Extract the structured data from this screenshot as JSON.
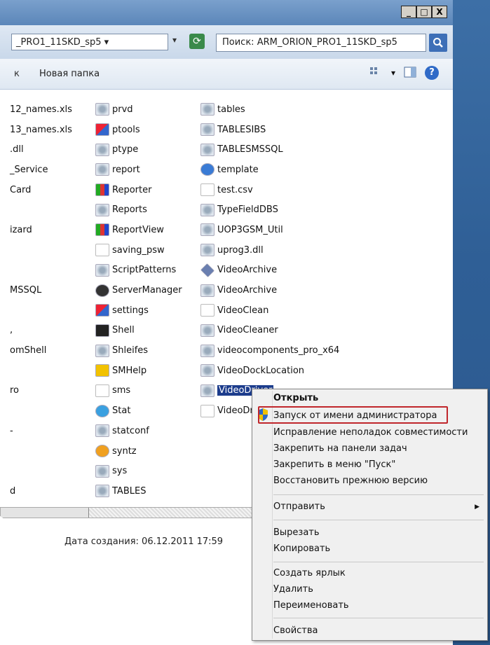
{
  "window": {
    "controls": [
      "_",
      "□",
      "X"
    ]
  },
  "address": {
    "path": "_PRO1_11SKD_sp5 ▾",
    "dropdown": "▾",
    "search_text": "Поиск: ARM_ORION_PRO1_11SKD_sp5"
  },
  "toolbar": {
    "back_label": "к",
    "new_folder_label": "Новая папка",
    "view_icon": "view-icon",
    "dropdown": "▾"
  },
  "files": {
    "col1": [
      "12_names.xls",
      "13_names.xls",
      ".dll",
      "_Service",
      "Card",
      "",
      "izard",
      "",
      "",
      "MSSQL",
      "",
      ",",
      "omShell",
      "",
      "ro",
      "",
      "-",
      "",
      "",
      "d"
    ],
    "col2": [
      {
        "name": "prvd",
        "icon": "gear"
      },
      {
        "name": "ptools",
        "icon": "app"
      },
      {
        "name": "ptype",
        "icon": "gear"
      },
      {
        "name": "report",
        "icon": "gear"
      },
      {
        "name": "Reporter",
        "icon": "chart"
      },
      {
        "name": "Reports",
        "icon": "gear"
      },
      {
        "name": "ReportView",
        "icon": "chart"
      },
      {
        "name": "saving_psw",
        "icon": "blank"
      },
      {
        "name": "ScriptPatterns",
        "icon": "gear"
      },
      {
        "name": "ServerManager",
        "icon": "dark"
      },
      {
        "name": "settings",
        "icon": "app"
      },
      {
        "name": "Shell",
        "icon": "shell"
      },
      {
        "name": "Shleifes",
        "icon": "gear"
      },
      {
        "name": "SMHelp",
        "icon": "help"
      },
      {
        "name": "sms",
        "icon": "blank"
      },
      {
        "name": "Stat",
        "icon": "stat"
      },
      {
        "name": "statconf",
        "icon": "gear"
      },
      {
        "name": "syntz",
        "icon": "syntz"
      },
      {
        "name": "sys",
        "icon": "gear"
      },
      {
        "name": "TABLES",
        "icon": "gear"
      }
    ],
    "col3": [
      {
        "name": "tables",
        "icon": "gear"
      },
      {
        "name": "TABLESIBS",
        "icon": "gear"
      },
      {
        "name": "TABLESMSSQL",
        "icon": "gear"
      },
      {
        "name": "template",
        "icon": "ie"
      },
      {
        "name": "test.csv",
        "icon": "blank"
      },
      {
        "name": "TypeFieldDBS",
        "icon": "gear"
      },
      {
        "name": "UOP3GSM_Util",
        "icon": "gear"
      },
      {
        "name": "uprog3.dll",
        "icon": "gear"
      },
      {
        "name": "VideoArchive",
        "icon": "diamond"
      },
      {
        "name": "VideoArchive",
        "icon": "gear"
      },
      {
        "name": "VideoClean",
        "icon": "blank"
      },
      {
        "name": "VideoCleaner",
        "icon": "gear"
      },
      {
        "name": "videocomponents_pro_x64",
        "icon": "gear"
      },
      {
        "name": "VideoDockLocation",
        "icon": "gear"
      },
      {
        "name": "VideoDriver",
        "icon": "gear",
        "selected": true
      },
      {
        "name": "VideoDr",
        "icon": "blank"
      }
    ]
  },
  "status": {
    "created": "Дата создания: 06.12.2011 17:59"
  },
  "context_menu": {
    "open": "Открыть",
    "run_as_admin": "Запуск от имени администратора",
    "compat": "Исправление неполадок совместимости",
    "pin_taskbar": "Закрепить на панели задач",
    "pin_start": "Закрепить в меню \"Пуск\"",
    "restore": "Восстановить прежнюю версию",
    "send_to": "Отправить",
    "send_to_arrow": "▶",
    "cut": "Вырезать",
    "copy": "Копировать",
    "create_shortcut": "Создать ярлык",
    "delete": "Удалить",
    "rename": "Переименовать",
    "properties": "Свойства"
  },
  "colors": {
    "highlight_box": "#c0262b",
    "selection": "#1c3c8c"
  }
}
